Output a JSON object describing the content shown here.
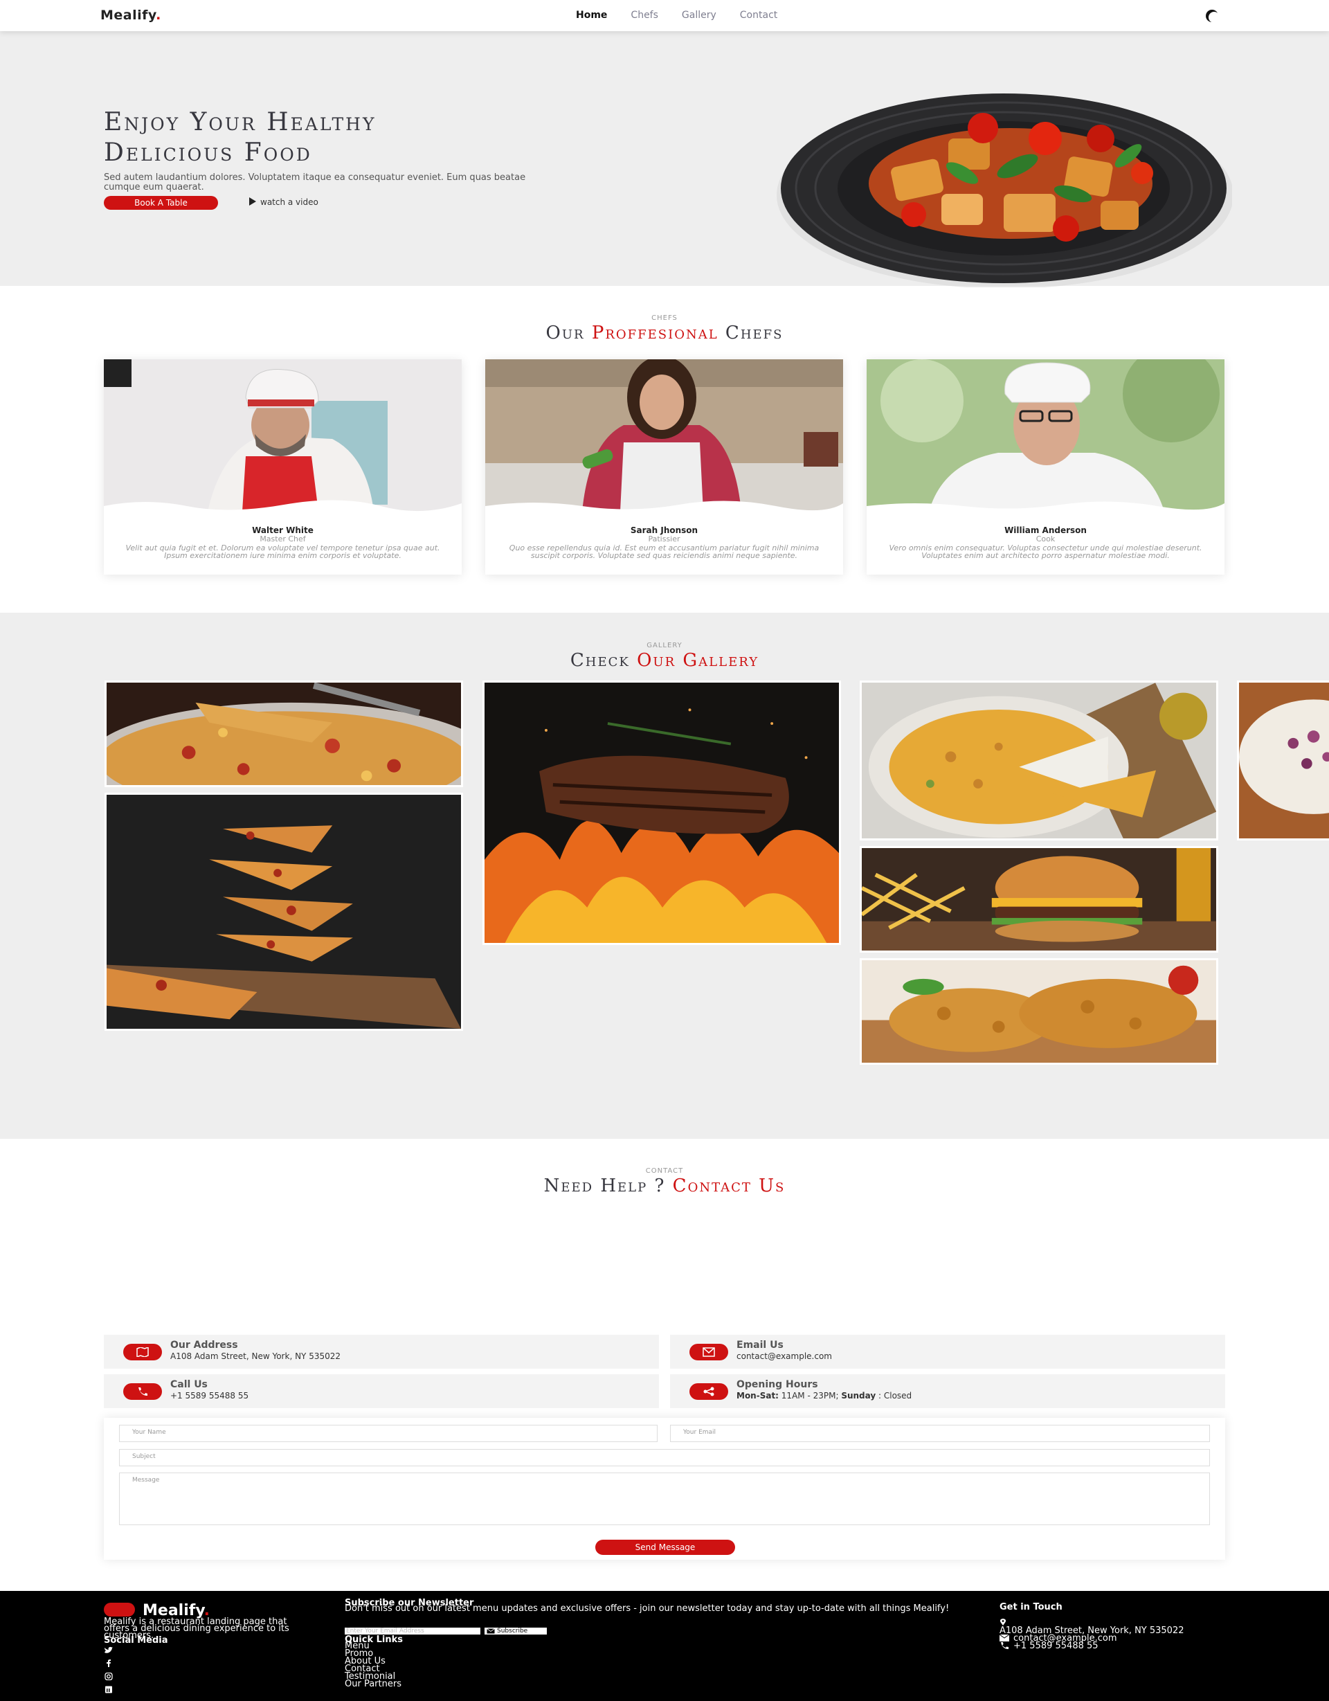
{
  "brand": {
    "name": "Mealify",
    "dot": "."
  },
  "nav": {
    "items": [
      "Home",
      "Chefs",
      "Gallery",
      "Contact"
    ],
    "active": "Home"
  },
  "hero": {
    "title_line1": "Enjoy Your Healthy",
    "title_line2": "Delicious Food",
    "subtitle": "Sed autem laudantium dolores. Voluptatem itaque ea consequatur eveniet. Eum quas beatae cumque eum quaerat.",
    "book_button": "Book A Table",
    "watch_link": "watch a video"
  },
  "chefs": {
    "tag": "CHEFS",
    "title_a": "Our",
    "title_b": "Proffesional",
    "title_c": "Chefs",
    "items": [
      {
        "name": "Walter White",
        "role": "Master Chef",
        "text": "Velit aut quia fugit et et. Dolorum ea voluptate vel tempore tenetur ipsa quae aut. Ipsum exercitationem iure minima enim corporis et voluptate."
      },
      {
        "name": "Sarah Jhonson",
        "role": "Patissier",
        "text": "Quo esse repellendus quia id. Est eum et accusantium pariatur fugit nihil minima suscipit corporis. Voluptate sed quas reiciendis animi neque sapiente."
      },
      {
        "name": "William Anderson",
        "role": "Cook",
        "text": "Vero omnis enim consequatur. Voluptas consectetur unde qui molestiae deserunt. Voluptates enim aut architecto porro aspernatur molestiae modi."
      }
    ]
  },
  "gallery": {
    "tag": "GALLERY",
    "title_a": "Check",
    "title_b": "Our Gallery",
    "images": [
      "pizza-slice",
      "flying-pizza",
      "grilled-steak",
      "frittata",
      "burger-fries",
      "fried-chicken",
      "wrap"
    ]
  },
  "contact": {
    "tag": "CONTACT",
    "title_a": "Need Help ?",
    "title_b": "Contact Us",
    "address_title": "Our Address",
    "address": "A108 Adam Street, New York, NY 535022",
    "email_title": "Email Us",
    "email": "contact@example.com",
    "call_title": "Call Us",
    "phone": "+1 5589 55488 55",
    "hours_title": "Opening Hours",
    "hours_days": "Mon-Sat:",
    "hours_time": " 11AM - 23PM; ",
    "hours_sunday": "Sunday",
    "hours_closed": " : Closed",
    "form": {
      "name_placeholder": "Your Name",
      "email_placeholder": "Your Email",
      "subject_placeholder": "Subject",
      "message_placeholder": "Message",
      "send_button": "Send Message"
    }
  },
  "footer": {
    "about": "Mealify is a restaurant landing page that offers a delicious dining experience to its customers.",
    "social_title": "Social Media",
    "social_icons": [
      "twitter-icon",
      "facebook-icon",
      "instagram-icon",
      "linkedin-icon"
    ],
    "newsletter_title": "Subscribe our Newsletter",
    "newsletter_text": "Don't miss out on our latest menu updates and exclusive offers - join our newsletter today and stay up-to-date with all things Mealify!",
    "newsletter_placeholder": "Enter Your Email Address",
    "subscribe_button": "Subscribe",
    "quick_links_title": "Quick Links",
    "quick_links": [
      "Menu",
      "Promo",
      "About Us",
      "Contact",
      "Testimonial",
      "Our Partners"
    ],
    "touch_title": "Get in Touch",
    "address": "A108 Adam Street, New York, NY 535022",
    "email": "contact@example.com",
    "phone": "+1 5589 55488 55"
  },
  "colors": {
    "accent": "#ce1212",
    "section_bg": "#eeeeee",
    "footer_bg": "#000000"
  }
}
